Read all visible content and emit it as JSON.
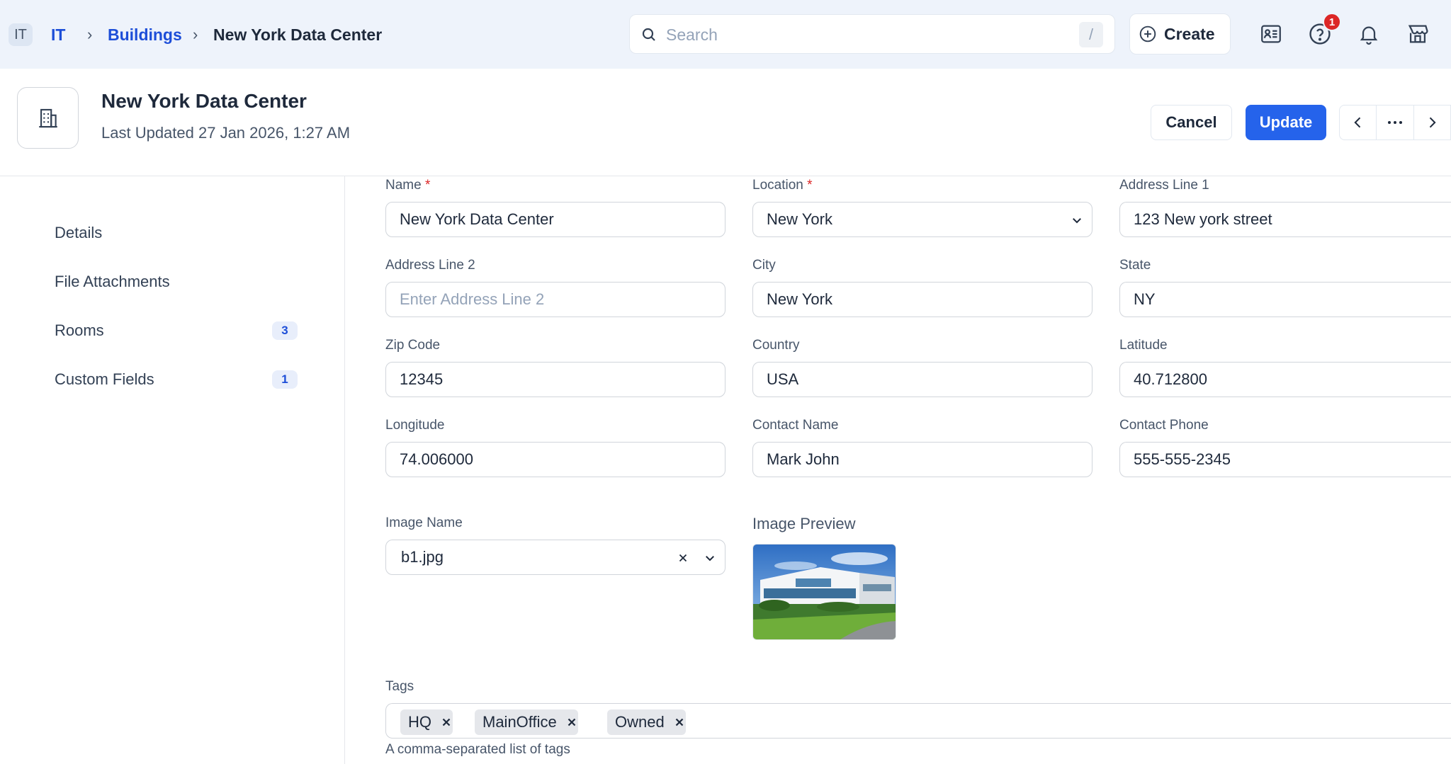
{
  "topbar": {
    "workspace_badge": "IT",
    "breadcrumb": [
      "IT",
      "Buildings",
      "New York Data Center"
    ],
    "search_placeholder": "Search",
    "search_shortcut": "/",
    "create_label": "Create",
    "notification_count": "1",
    "icons": [
      "contacts-icon",
      "help-icon",
      "bell-icon",
      "store-icon"
    ]
  },
  "header": {
    "title": "New York Data Center",
    "subtitle": "Last Updated 27 Jan 2026, 1:27 AM",
    "cancel_label": "Cancel",
    "update_label": "Update"
  },
  "sidebar": {
    "items": [
      {
        "label": "Details",
        "count": null
      },
      {
        "label": "File Attachments",
        "count": null
      },
      {
        "label": "Rooms",
        "count": "3"
      },
      {
        "label": "Custom Fields",
        "count": "1"
      }
    ]
  },
  "form": {
    "name": {
      "label": "Name",
      "value": "New York Data Center"
    },
    "location": {
      "label": "Location",
      "value": "New York"
    },
    "address1": {
      "label": "Address Line 1",
      "value": "123 New york street"
    },
    "address2": {
      "label": "Address Line 2",
      "placeholder": "Enter Address Line 2"
    },
    "city": {
      "label": "City",
      "value": "New York"
    },
    "state": {
      "label": "State",
      "value": "NY"
    },
    "zip": {
      "label": "Zip Code",
      "value": "12345"
    },
    "country": {
      "label": "Country",
      "value": "USA"
    },
    "latitude": {
      "label": "Latitude",
      "value": "40.712800"
    },
    "longitude": {
      "label": "Longitude",
      "value": "74.006000"
    },
    "contact_name": {
      "label": "Contact Name",
      "value": "Mark John"
    },
    "contact_phone": {
      "label": "Contact Phone",
      "value": "555-555-2345"
    },
    "image_name": {
      "label": "Image Name",
      "value": "b1.jpg"
    },
    "image_preview_label": "Image Preview",
    "tags": {
      "label": "Tags",
      "values": [
        "HQ",
        "MainOffice",
        "Owned"
      ],
      "help": "A comma-separated list of tags"
    },
    "required_marker": "*"
  },
  "colors": {
    "accent": "#2563eb",
    "link": "#1d4ed8",
    "badge_red": "#dc2626",
    "topbar_bg": "#eef3fb"
  }
}
